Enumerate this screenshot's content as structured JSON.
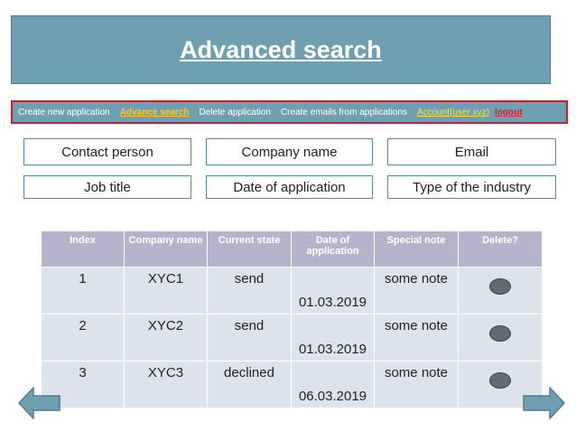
{
  "header": {
    "title": "Advanced search"
  },
  "menu": {
    "items": [
      {
        "label": "Create new application",
        "style": "normal"
      },
      {
        "label": "Advance search",
        "style": "active"
      },
      {
        "label": "Delete application",
        "style": "normal"
      },
      {
        "label": "Create emails from applications",
        "style": "normal"
      },
      {
        "label": "Account(user xyz)",
        "style": "account"
      },
      {
        "label": "logout",
        "style": "logout"
      }
    ]
  },
  "filters": {
    "contact_person": "Contact person",
    "company_name": "Company name",
    "email": "Email",
    "job_title": "Job title",
    "date_of_application": "Date of application",
    "type_of_industry": "Type of the industry"
  },
  "table": {
    "columns": [
      "Index",
      "Company name",
      "Current state",
      "Date of application",
      "Special note",
      "Delete?"
    ],
    "rows": [
      {
        "index": "1",
        "company": "XYC1",
        "state": "send",
        "date": "01.03.2019",
        "note": "some note"
      },
      {
        "index": "2",
        "company": "XYC2",
        "state": "send",
        "date": "01.03.2019",
        "note": "some note"
      },
      {
        "index": "3",
        "company": "XYC3",
        "state": "declined",
        "date": "06.03.2019",
        "note": "some note"
      }
    ]
  },
  "colors": {
    "header_bg": "#6fa0b2",
    "menu_border": "#d01c2c",
    "active_link": "#f6c829",
    "logout_link": "#e0202a",
    "table_header_bg": "#b6b4cc",
    "table_cell_bg": "#dde3ea"
  },
  "icons": {
    "back": "arrow-left-icon",
    "forward": "arrow-right-icon",
    "delete": "delete-dot-icon"
  }
}
